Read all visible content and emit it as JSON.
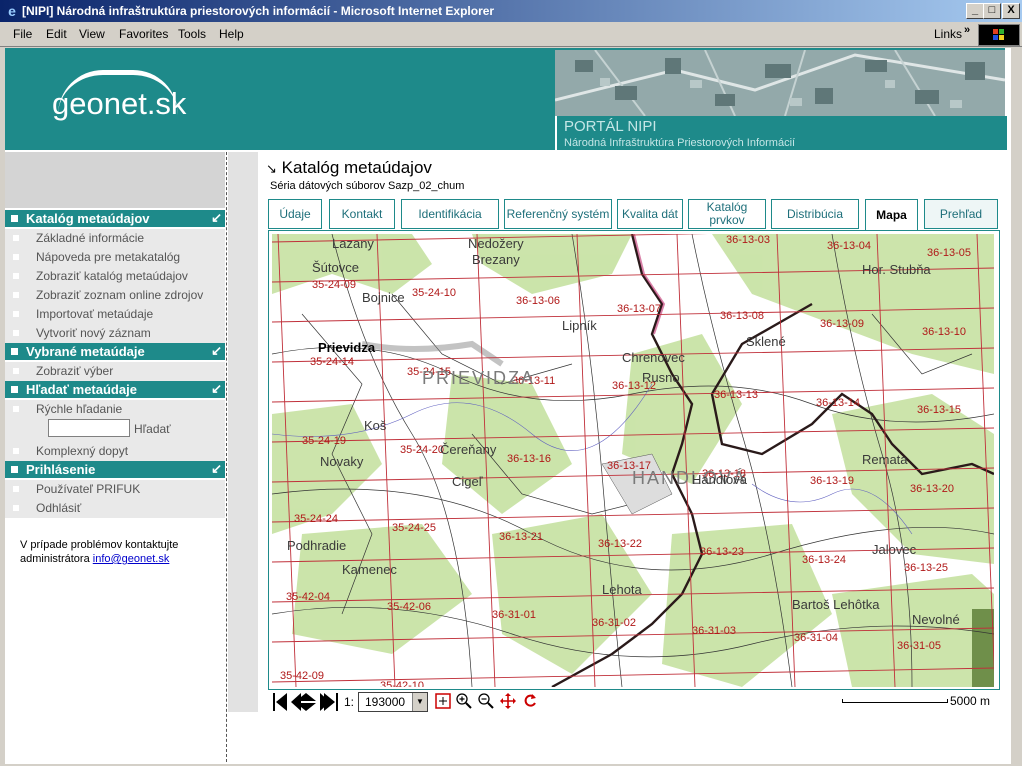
{
  "window": {
    "title": "[NIPI] Národná infraštruktúra priestorových informácií - Microsoft Internet Explorer",
    "btn_min": "_",
    "btn_max": "□",
    "btn_close": "X"
  },
  "menu": {
    "items": [
      {
        "key": "F",
        "rest": "ile"
      },
      {
        "key": "E",
        "rest": "dit"
      },
      {
        "key": "V",
        "rest": "iew"
      },
      {
        "pre": "F",
        "key": "a",
        "rest": "vorites"
      },
      {
        "key": "T",
        "rest": "ools"
      },
      {
        "key": "H",
        "rest": "elp"
      }
    ],
    "labels": [
      "File",
      "Edit",
      "View",
      "Favorites",
      "Tools",
      "Help"
    ],
    "links": "Links",
    "links_chevron": "»"
  },
  "header": {
    "logo": "geonet.sk",
    "portal_title": "PORTÁL NIPI",
    "portal_subtitle": "Národná Infraštruktúra Priestorových Informácií"
  },
  "sidebar": {
    "sections": [
      {
        "title": "Katalóg metaúdajov",
        "items": [
          "Základné informácie",
          "Nápoveda pre metakatalóg",
          "Zobraziť katalóg metaúdajov",
          "Zobraziť zoznam online zdrojov",
          "Importovať metaúdaje",
          "Vytvoriť nový záznam"
        ]
      },
      {
        "title": "Vybrané metaúdaje",
        "items": [
          "Zobraziť výber"
        ]
      },
      {
        "title": "Hľadať metaúdaje",
        "items": [
          "Rýchle hľadanie",
          "Komplexný dopyt"
        ],
        "search_button": "Hľadať",
        "search_value": ""
      },
      {
        "title": "Prihlásenie",
        "items": [
          "Používateľ PRIFUK",
          "Odhlásiť"
        ]
      }
    ],
    "contact_line1": "V prípade problémov kontaktujte",
    "contact_line2": "administrátora",
    "contact_email": "info@geonet.sk"
  },
  "content": {
    "title": "Katalóg metaúdajov",
    "subtitle": "Séria dátových súborov Sazp_02_chum",
    "tabs": [
      "Údaje",
      "Kontakt",
      "Identifikácia",
      "Referenčný systém",
      "Kvalita dát",
      "Katalóg prvkov",
      "Distribúcia",
      "Mapa",
      "Prehľad"
    ],
    "active_tab": "Mapa"
  },
  "map": {
    "sheet_labels": [
      "36-13-03",
      "36-13-04",
      "36-13-05",
      "35-24-09",
      "35-24-10",
      "36-13-06",
      "36-13-07",
      "36-13-08",
      "36-13-09",
      "36-13-10",
      "35-24-14",
      "35-24-15",
      "36-13-11",
      "36-13-12",
      "36-13-13",
      "36-13-14",
      "36-13-15",
      "35-24-19",
      "35-24-20",
      "36-13-16",
      "36-13-17",
      "36-13-18",
      "36-13-19",
      "36-13-20",
      "35-24-24",
      "35-24-25",
      "36-13-21",
      "36-13-22",
      "36-13-23",
      "36-13-24",
      "36-13-25",
      "35-42-04",
      "35-42-06",
      "36-31-01",
      "36-31-02",
      "36-31-03",
      "36-31-04",
      "36-31-05",
      "35-42-09",
      "35-42-10"
    ],
    "place_names": [
      "Nedožery",
      "Brezany",
      "Lazany",
      "Šútovce",
      "Bojnice",
      "Prievidza",
      "PRIEVIDZA",
      "Lipník",
      "Chrenovec",
      "Rusno",
      "Sklené",
      "Hor. Stubňa",
      "Koš",
      "Novaky",
      "Čereňany",
      "Cigeľ",
      "HANDLOVÁ",
      "Lehota",
      "Kamenec",
      "Bartoš Lehôtka",
      "Nevolné",
      "Remata",
      "Jalovec",
      "Podhradie",
      "Handlová"
    ],
    "scale_prefix": "1:",
    "scale_value": "193000",
    "scalebar_label": "5000 m",
    "colors": {
      "grid": "#c0303a",
      "border": "#2a1a1a",
      "woods": "#c8e3a8",
      "land": "#ffffff",
      "river": "#6060c0"
    }
  },
  "toolbar_icons": [
    "pan-west-icon",
    "pan-north-icon",
    "pan-south-icon",
    "pan-east-icon",
    "full-extent-icon",
    "zoom-in-icon",
    "zoom-out-icon",
    "pan-icon",
    "refresh-icon"
  ],
  "colors": {
    "teal": "#1e8a8a",
    "teal_text": "#1e6f7a"
  }
}
